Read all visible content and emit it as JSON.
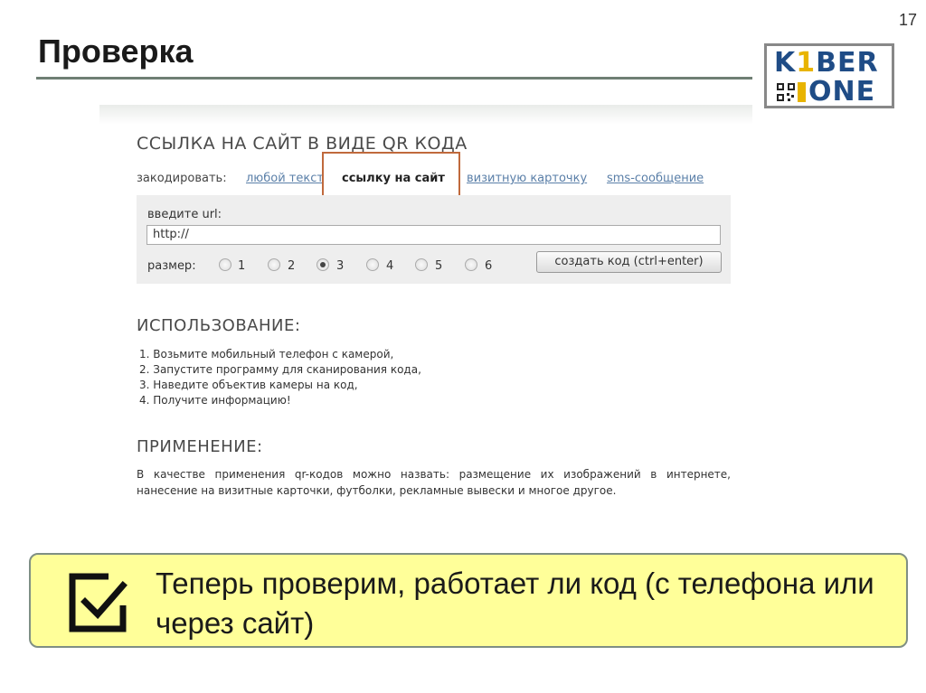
{
  "slide": {
    "title": "Проверка",
    "number": "17"
  },
  "logo": {
    "line1_k": "K",
    "line1_one": "1",
    "line1_rest": "BER",
    "line2": "ONE"
  },
  "screenshot": {
    "heading": "ССЫЛКА НА САЙТ В ВИДЕ QR КОДА",
    "encode_label": "закодировать:",
    "encode_options": [
      "любой текст",
      "ссылку на сайт",
      "визитную карточку",
      "sms-сообщение"
    ],
    "url_label": "введите url:",
    "url_value": "http://",
    "size_label": "размер:",
    "sizes": [
      "1",
      "2",
      "3",
      "4",
      "5",
      "6"
    ],
    "selected_size": "3",
    "create_button": "создать код (ctrl+enter)",
    "usage_heading": "ИСПОЛЬЗОВАНИЕ:",
    "usage_steps": [
      "1. Возьмите мобильный телефон с камерой,",
      "2. Запустите программу для сканирования кода,",
      "3. Наведите объектив камеры на код,",
      "4. Получите информацию!"
    ],
    "apply_heading": "ПРИМЕНЕНИЕ:",
    "apply_text": "В качестве применения qr-кодов можно назвать: размещение их изображений в интернете, нанесение на визитные карточки, футболки, рекламные вывески и многое другое."
  },
  "callout": {
    "text": "Теперь проверим, работает ли код (с телефона или через сайт)"
  },
  "colors": {
    "accent_box": "#c0693c",
    "callout_bg": "#ffff99",
    "logo_blue": "#1f4c86",
    "logo_yellow": "#e8b400",
    "link": "#5a7fa8"
  }
}
